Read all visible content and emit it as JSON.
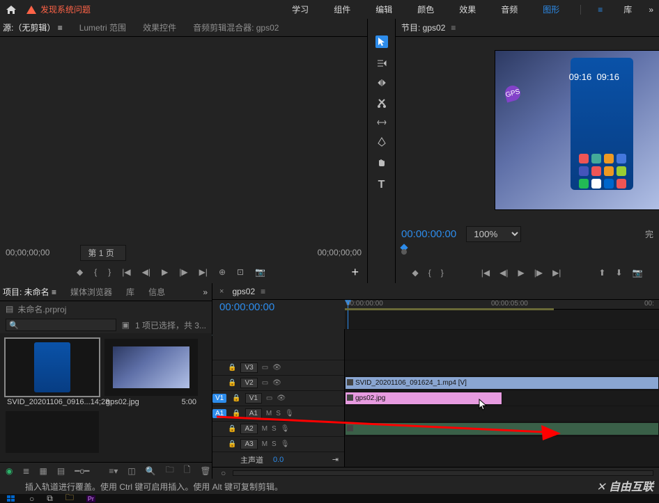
{
  "topbar": {
    "warning_text": "发现系统问题",
    "tabs": [
      "学习",
      "组件",
      "编辑",
      "颜色",
      "效果",
      "音频",
      "图形",
      "库"
    ],
    "active_tab_index": 6
  },
  "source_panel": {
    "tabs": [
      "源:（无剪辑）",
      "Lumetri 范围",
      "效果控件",
      "音频剪辑混合器: gps02"
    ],
    "active_index": 0,
    "tc_in": "00;00;00;00",
    "pager": "第 1 页",
    "tc_out": "00;00;00;00"
  },
  "program_panel": {
    "tab_label": "节目: gps02",
    "tc": "00:00:00:00",
    "zoom": "100%",
    "status": "完",
    "preview_time_1": "09:16",
    "preview_time_2": "09:16",
    "gps_badge": "GPS"
  },
  "project_panel": {
    "tabs": [
      "项目: 未命名",
      "媒体浏览器",
      "库",
      "信息"
    ],
    "active_index": 0,
    "project_file": "未命名.prproj",
    "selection_text": "1 项已选择，共 3...",
    "items": [
      {
        "name": "SVID_20201106_0916...",
        "duration": "14;28"
      },
      {
        "name": "gps02.jpg",
        "duration": "5:00"
      }
    ]
  },
  "timeline": {
    "sequence_name": "gps02",
    "tc": "00:00:00:00",
    "ruler_ticks": [
      "00:00:00:00",
      "00:00:05:00",
      "00:"
    ],
    "video_tracks": [
      "V3",
      "V2",
      "V1"
    ],
    "audio_tracks": [
      "A1",
      "A2",
      "A3"
    ],
    "src_v_label": "V1",
    "src_a_label": "A1",
    "master_label": "主声道",
    "master_value": "0.0",
    "clips": {
      "v2": "SVID_20201106_091624_1.mp4 [V]",
      "v1": "gps02.jpg"
    },
    "track_btn_mute": "M",
    "track_btn_solo": "S"
  },
  "statusbar": {
    "hint": "插入轨道进行覆盖。使用 Ctrl 键可启用插入。使用 Alt 键可复制剪辑。",
    "watermark": "自由互联"
  },
  "labels": {
    "menu_icon": "≡",
    "more": "»",
    "close": "×",
    "lock": "🔒",
    "eye": "👁",
    "mic": "🎙",
    "plus": "+",
    "mark_in": "{",
    "mark_out": "}",
    "marker": "◆",
    "step_back": "◀|",
    "step_fwd": "|▶",
    "play": "▶",
    "prev": "|◀◀",
    "next": "▶▶|",
    "export": "⤓",
    "camera": "📷",
    "go_start": "|◀",
    "go_end": "▶|"
  }
}
